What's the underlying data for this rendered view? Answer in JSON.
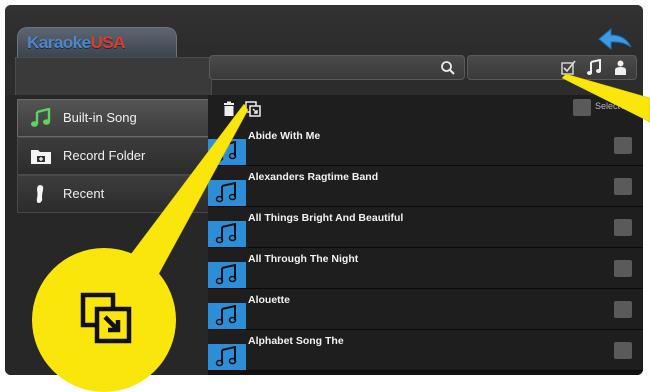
{
  "header": {
    "logo_main": "Karaoke",
    "logo_accent": "USA"
  },
  "sidebar": {
    "items": [
      {
        "label": "Built-in Song",
        "icon": "music-note-icon",
        "active": true
      },
      {
        "label": "Record Folder",
        "icon": "folder-add-icon",
        "active": false
      },
      {
        "label": "Recent",
        "icon": "footprint-icon",
        "active": false
      }
    ]
  },
  "toolbar": {
    "select_all_label": "Select All"
  },
  "songs": [
    {
      "title": "Abide With Me"
    },
    {
      "title": "Alexanders Ragtime Band"
    },
    {
      "title": "All Things Bright And Beautiful"
    },
    {
      "title": "All Through The Night"
    },
    {
      "title": "Alouette"
    },
    {
      "title": "Alphabet Song The"
    }
  ],
  "colors": {
    "accent_blue": "#2d8ed8",
    "callout_yellow": "#fbe60b",
    "logo_red": "#e23a2a"
  }
}
